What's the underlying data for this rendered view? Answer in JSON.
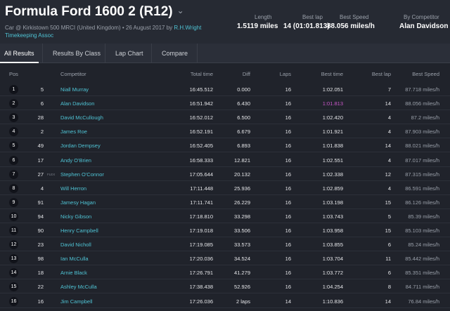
{
  "header": {
    "title": "Formula Ford 1600 2 (R12)",
    "subtitle_prefix": "Car @ Kirkistown 500 MRCI (United Kingdom) • 26 August 2017 by",
    "author": "R.H.Wright",
    "org": "Timekeeping Assoc",
    "stats": {
      "length_label": "Length",
      "length_value": "1.5119 miles",
      "bestlap_label": "Best lap",
      "bestlap_value": "14 (01:01.813)",
      "bestspeed_label": "Best Speed",
      "bestspeed_value": "88.056 miles/h",
      "bycomp_label": "By Competitor",
      "bycomp_value": "Alan Davidson"
    }
  },
  "tabs": [
    {
      "label": "All Results"
    },
    {
      "label": "Results By Class"
    },
    {
      "label": "Lap Chart"
    },
    {
      "label": "Compare"
    }
  ],
  "columns": {
    "pos": "Pos",
    "competitor": "Competitor",
    "total": "Total time",
    "diff": "Diff",
    "laps": "Laps",
    "best_time": "Best time",
    "best_lap": "Best lap",
    "best_speed": "Best Speed"
  },
  "rows": [
    {
      "pos": "1",
      "no": "5",
      "tag": "",
      "name": "Niall Murray",
      "total": "16:45.512",
      "diff": "0.000",
      "laps": "16",
      "best": "1:02.051",
      "bestlap": "7",
      "speed": "87.718 miles/h"
    },
    {
      "pos": "2",
      "no": "6",
      "tag": "",
      "name": "Alan Davidson",
      "total": "16:51.942",
      "diff": "6.430",
      "laps": "16",
      "best": "1:01.813",
      "bestlap": "14",
      "speed": "88.056 miles/h"
    },
    {
      "pos": "3",
      "no": "28",
      "tag": "",
      "name": "David McCullough",
      "total": "16:52.012",
      "diff": "6.500",
      "laps": "16",
      "best": "1:02.420",
      "bestlap": "4",
      "speed": "87.2 miles/h"
    },
    {
      "pos": "4",
      "no": "2",
      "tag": "",
      "name": "James Roe",
      "total": "16:52.191",
      "diff": "6.679",
      "laps": "16",
      "best": "1:01.921",
      "bestlap": "4",
      "speed": "87.903 miles/h"
    },
    {
      "pos": "5",
      "no": "49",
      "tag": "",
      "name": "Jordan Dempsey",
      "total": "16:52.405",
      "diff": "6.893",
      "laps": "16",
      "best": "1:01.838",
      "bestlap": "14",
      "speed": "88.021 miles/h"
    },
    {
      "pos": "6",
      "no": "17",
      "tag": "",
      "name": "Andy O'Brien",
      "total": "16:58.333",
      "diff": "12.821",
      "laps": "16",
      "best": "1:02.551",
      "bestlap": "4",
      "speed": "87.017 miles/h"
    },
    {
      "pos": "7",
      "no": "27",
      "tag": "FLEX",
      "name": "Stephen O'Connor",
      "total": "17:05.644",
      "diff": "20.132",
      "laps": "16",
      "best": "1:02.338",
      "bestlap": "12",
      "speed": "87.315 miles/h"
    },
    {
      "pos": "8",
      "no": "4",
      "tag": "",
      "name": "Will Herron",
      "total": "17:11.448",
      "diff": "25.936",
      "laps": "16",
      "best": "1:02.859",
      "bestlap": "4",
      "speed": "86.591 miles/h"
    },
    {
      "pos": "9",
      "no": "91",
      "tag": "",
      "name": "Jamesy Hagan",
      "total": "17:11.741",
      "diff": "26.229",
      "laps": "16",
      "best": "1:03.198",
      "bestlap": "15",
      "speed": "86.126 miles/h"
    },
    {
      "pos": "10",
      "no": "94",
      "tag": "",
      "name": "Nicky Gibson",
      "total": "17:18.810",
      "diff": "33.298",
      "laps": "16",
      "best": "1:03.743",
      "bestlap": "5",
      "speed": "85.39 miles/h"
    },
    {
      "pos": "11",
      "no": "90",
      "tag": "",
      "name": "Henry Campbell",
      "total": "17:19.018",
      "diff": "33.506",
      "laps": "16",
      "best": "1:03.958",
      "bestlap": "15",
      "speed": "85.103 miles/h"
    },
    {
      "pos": "12",
      "no": "23",
      "tag": "",
      "name": "David Nicholl",
      "total": "17:19.085",
      "diff": "33.573",
      "laps": "16",
      "best": "1:03.855",
      "bestlap": "6",
      "speed": "85.24 miles/h"
    },
    {
      "pos": "13",
      "no": "98",
      "tag": "",
      "name": "Ian McCulla",
      "total": "17:20.036",
      "diff": "34.524",
      "laps": "16",
      "best": "1:03.704",
      "bestlap": "11",
      "speed": "85.442 miles/h"
    },
    {
      "pos": "14",
      "no": "18",
      "tag": "",
      "name": "Arnie Black",
      "total": "17:26.791",
      "diff": "41.279",
      "laps": "16",
      "best": "1:03.772",
      "bestlap": "6",
      "speed": "85.351 miles/h"
    },
    {
      "pos": "15",
      "no": "22",
      "tag": "",
      "name": "Ashley McCulla",
      "total": "17:38.438",
      "diff": "52.926",
      "laps": "16",
      "best": "1:04.254",
      "bestlap": "8",
      "speed": "84.711 miles/h"
    },
    {
      "pos": "16",
      "no": "16",
      "tag": "",
      "name": "Jim Campbell",
      "total": "17:26.036",
      "diff": "2 laps",
      "laps": "14",
      "best": "1:10.836",
      "bestlap": "14",
      "speed": "76.84 miles/h"
    }
  ],
  "colors": {
    "accent": "#4fc3d4",
    "best_highlight": "#c857c8",
    "background": "#20232b"
  }
}
